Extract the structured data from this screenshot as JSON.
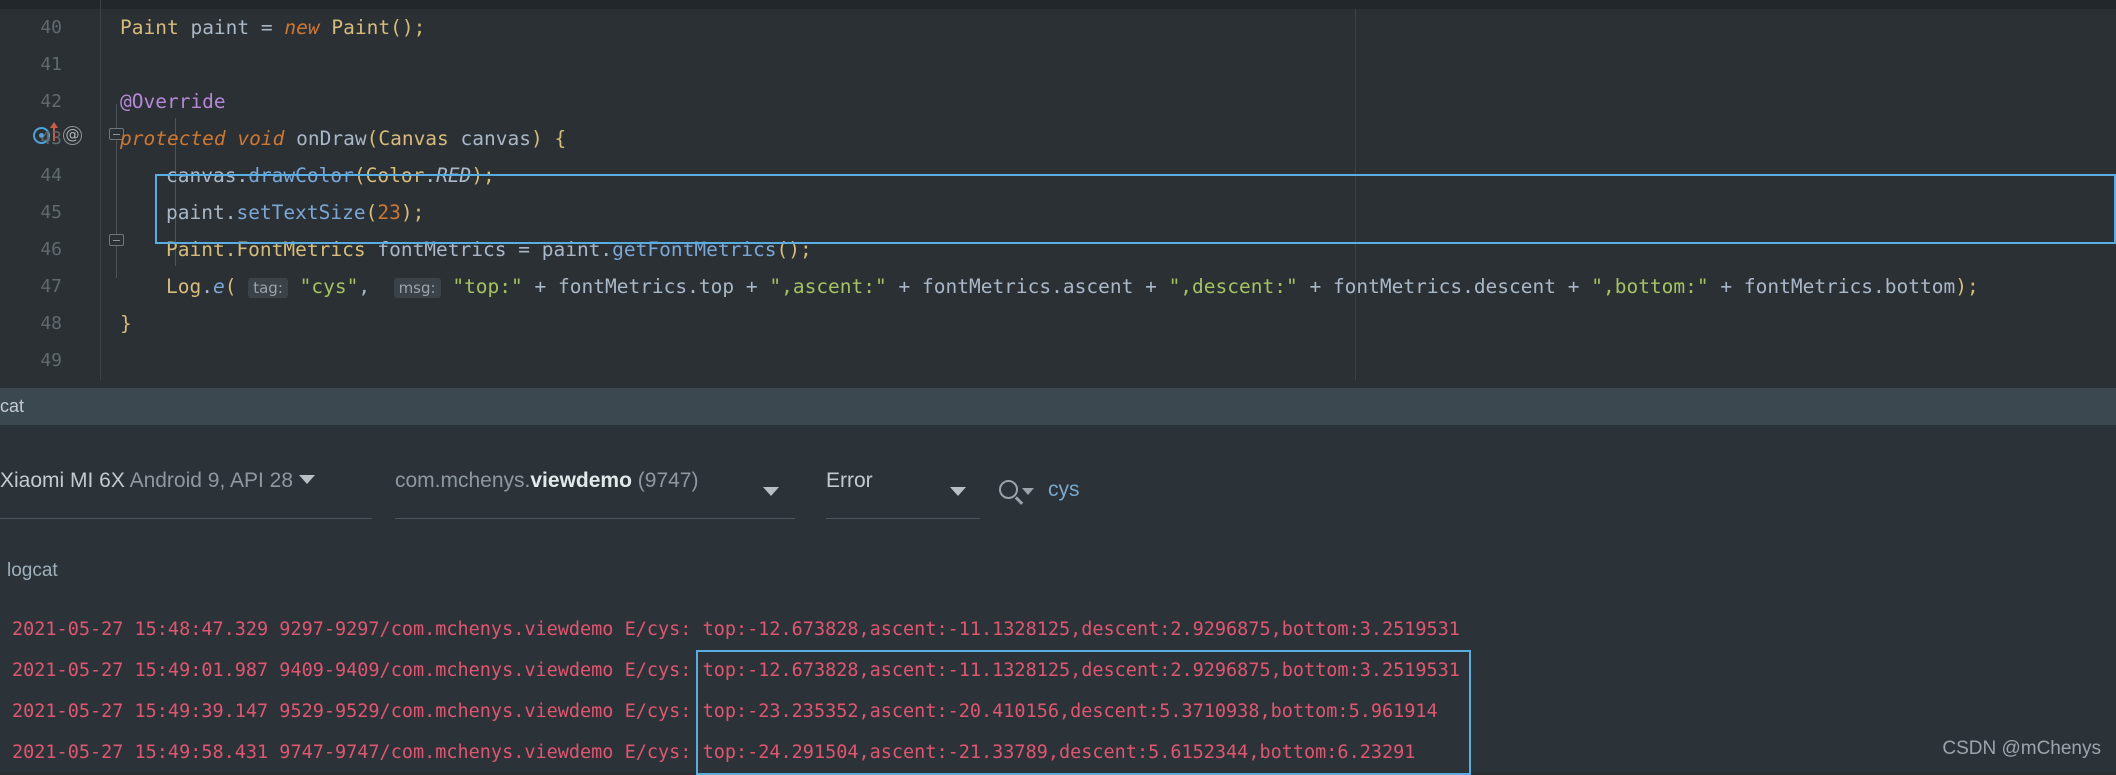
{
  "editor": {
    "gutter_icons": {
      "override_marker": "override-method-icon",
      "annotation_marker": "annotation-icon",
      "fold_open": "fold-open-icon",
      "fold_close": "fold-close-icon"
    },
    "lines": [
      {
        "no": "40",
        "text": "Paint paint = new Paint();"
      },
      {
        "no": "41",
        "text": ""
      },
      {
        "no": "42",
        "text": "@Override"
      },
      {
        "no": "43",
        "text": "protected void onDraw(Canvas canvas) {"
      },
      {
        "no": "44",
        "text": "canvas.drawColor(Color.RED);"
      },
      {
        "no": "45",
        "text": "paint.setTextSize(23);"
      },
      {
        "no": "46",
        "text": "Paint.FontMetrics fontMetrics = paint.getFontMetrics();"
      },
      {
        "no": "47",
        "text": "Log.e( tag: \"cys\",  msg: \"top:\" + fontMetrics.top + \",ascent:\" + fontMetrics.ascent + \",descent:\" + fontMetrics.descent + \",bottom:\" + fontMetrics.bottom);"
      },
      {
        "no": "48",
        "text": "}"
      },
      {
        "no": "49",
        "text": ""
      }
    ],
    "tokens": {
      "l40": {
        "type": "Paint",
        "var": "paint",
        "eq": "=",
        "new": "new",
        "ctor": "Paint",
        "parens": "();"
      },
      "l42": {
        "annotation": "@Override"
      },
      "l43": {
        "mod": "protected",
        "ret": "void",
        "name": "onDraw",
        "ptype": "Canvas",
        "pname": "canvas",
        "brace": "{"
      },
      "l44": {
        "recv": "canvas",
        "call": "drawColor",
        "cls": "Color",
        "field": "RED"
      },
      "l45": {
        "recv": "paint",
        "call": "setTextSize",
        "arg": "23"
      },
      "l46": {
        "type": "Paint.FontMetrics",
        "var": "fontMetrics",
        "recv": "paint",
        "call": "getFontMetrics"
      },
      "l47": {
        "cls": "Log",
        "call": "e",
        "hint_tag": "tag:",
        "tag_value": "\"cys\"",
        "hint_msg": "msg:",
        "s1": "\"top:\"",
        "f1": "fontMetrics.top",
        "s2": "\",ascent:\"",
        "f2": "fontMetrics.ascent",
        "s3": "\",descent:\"",
        "f3": "fontMetrics.descent",
        "s4": "\",bottom:\"",
        "f4": "fontMetrics.bottom"
      },
      "l48": {
        "brace": "}"
      }
    },
    "highlight_color": "#5aade0"
  },
  "logcat_tab": {
    "label": "cat"
  },
  "logcat_toolbar": {
    "device": {
      "name": "Xiaomi MI 6X",
      "detail": "Android 9, API 28"
    },
    "process": {
      "prefix": "com.mchenys.",
      "name": "viewdemo",
      "pid": "(9747)"
    },
    "level": "Error",
    "search_icon": "search-icon",
    "search_value": "cys"
  },
  "logcat_output": {
    "header": "logcat",
    "entries": [
      {
        "stamp": "2021-05-27 15:48:47.329 9297-9297/com.mchenys.viewdemo E/cys:",
        "message": "top:-12.673828,ascent:-11.1328125,descent:2.9296875,bottom:3.2519531"
      },
      {
        "stamp": "2021-05-27 15:49:01.987 9409-9409/com.mchenys.viewdemo E/cys:",
        "message": "top:-12.673828,ascent:-11.1328125,descent:2.9296875,bottom:3.2519531"
      },
      {
        "stamp": "2021-05-27 15:49:39.147 9529-9529/com.mchenys.viewdemo E/cys:",
        "message": "top:-23.235352,ascent:-20.410156,descent:5.3710938,bottom:5.961914"
      },
      {
        "stamp": "2021-05-27 15:49:58.431 9747-9747/com.mchenys.viewdemo E/cys:",
        "message": "top:-24.291504,ascent:-21.33789,descent:5.6152344,bottom:6.23291"
      }
    ],
    "text_color": "#e05570"
  },
  "watermark": "CSDN @mChenys"
}
